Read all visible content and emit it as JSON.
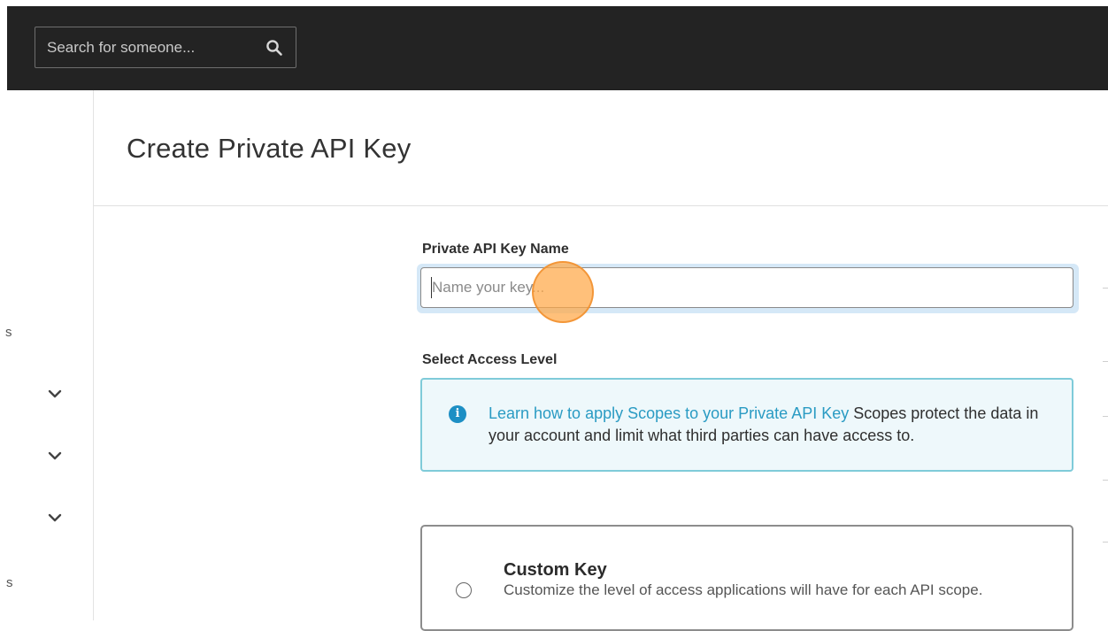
{
  "topbar": {
    "search_placeholder": "Search for someone...",
    "search_icon": "magnifier"
  },
  "sidebar": {
    "fragments": [
      "s",
      "s"
    ],
    "chevron_icon": "chevron-down"
  },
  "page": {
    "title": "Create Private API Key"
  },
  "form": {
    "name_label": "Private API Key Name",
    "name_placeholder": "Name your key...",
    "name_value": "",
    "access_label": "Select Access Level",
    "info": {
      "icon": "info-circle",
      "link_text": "Learn how to apply Scopes to your Private API Key",
      "body_text": " Scopes protect the data in your account and limit what third parties can have access to."
    },
    "custom_key": {
      "title": "Custom Key",
      "description": "Customize the level of access applications will have for each API scope.",
      "selected": false
    }
  },
  "colors": {
    "topbar_bg": "#232323",
    "focus_ring": "#d5e8f7",
    "info_border": "#7fcbd9",
    "info_bg": "#eef8fb",
    "link": "#2a9bc3",
    "click_indicator": "#ffa846"
  }
}
